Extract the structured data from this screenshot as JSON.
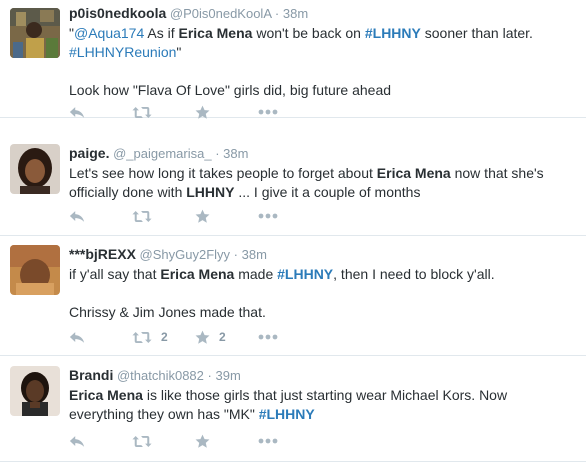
{
  "tweets": [
    {
      "name": "p0is0nedkoola",
      "handle": "@P0is0nedKoolA",
      "separator": "·",
      "time": "38m",
      "text": {
        "l1a": "\"",
        "l1_mention": "@Aqua174",
        "l1b": " As if ",
        "l1_bold": "Erica Mena",
        "l1c": " won't be back on ",
        "l1_tag": "#LHHNY",
        "l1d": " sooner than later.",
        "l2_tag": "#LHHNYReunion",
        "l2a": "\"",
        "l3": "Look how \"Flava Of Love\" girls did, big future ahead"
      },
      "retweets": "",
      "favorites": ""
    },
    {
      "name": "paige.",
      "handle": "@_paigemarisa_",
      "separator": "·",
      "time": "38m",
      "text": {
        "l1a": "Let's see how long it takes people to forget about ",
        "l1_bold": "Erica Mena",
        "l1b": " now that she's",
        "l2a": "officially done with ",
        "l2_bold": "LHHNY",
        "l2b": " ... I give it a couple of months"
      },
      "retweets": "",
      "favorites": ""
    },
    {
      "name": "***bjREXX",
      "handle": "@ShyGuy2Flyy",
      "separator": "·",
      "time": "38m",
      "text": {
        "l1a": "if y'all say that ",
        "l1_bold": "Erica Mena",
        "l1b": " made ",
        "l1_tag": "#LHHNY",
        "l1c": ", then I need to block y'all.",
        "l3": "Chrissy & Jim Jones made that."
      },
      "retweets": "2",
      "favorites": "2"
    },
    {
      "name": "Brandi",
      "handle": "@thatchik0882",
      "separator": "·",
      "time": "39m",
      "text": {
        "l1_bold": "Erica Mena",
        "l1a": " is like those girls that just starting wear Michael Kors. Now",
        "l2a": "everything they own has \"MK\" ",
        "l2_tag": "#LHHNY"
      },
      "retweets": "",
      "favorites": ""
    }
  ],
  "colors": {
    "text": "#292f33",
    "muted": "#8899a6",
    "link": "#2b7bb9",
    "icon": "#aab8c2",
    "divider": "#e1e8ed"
  },
  "icons": [
    "reply-icon",
    "retweet-icon",
    "favorite-icon",
    "more-icon"
  ]
}
